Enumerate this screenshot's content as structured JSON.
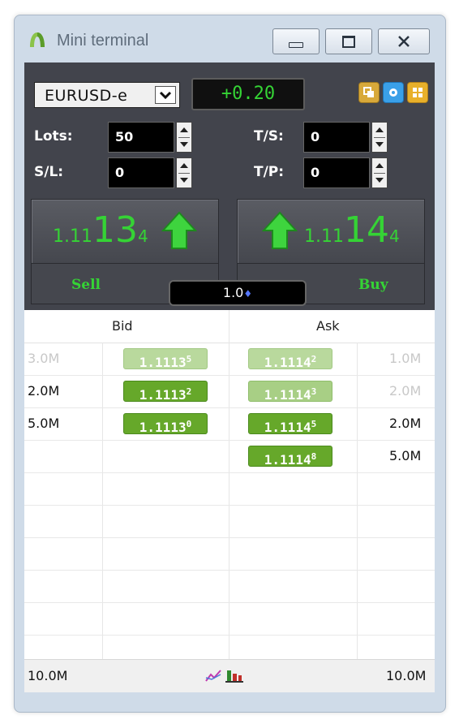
{
  "window": {
    "title": "Mini terminal",
    "buttons": {
      "minimize": "minimize",
      "maximize": "maximize",
      "close": "close"
    }
  },
  "header": {
    "symbol": "EURUSD-e",
    "profit": "+0.20",
    "tools": [
      "copy-icon",
      "settings-icon",
      "grid-icon"
    ]
  },
  "fields": {
    "lots": {
      "label": "Lots:",
      "value": "50"
    },
    "sl": {
      "label": "S/L:",
      "value": "0"
    },
    "ts": {
      "label": "T/S:",
      "value": "0"
    },
    "tp": {
      "label": "T/P:",
      "value": "0"
    }
  },
  "sell": {
    "pre": "1.11",
    "big": "13",
    "sup": "4",
    "label": "Sell"
  },
  "buy": {
    "pre": "1.11",
    "big": "14",
    "sup": "4",
    "label": "Buy"
  },
  "volume": "1.0",
  "book": {
    "headers": {
      "bid": "Bid",
      "ask": "Ask"
    },
    "rows": [
      {
        "bid_vol": "3.0M",
        "bid_price": "1.1113",
        "bid_sup": "5",
        "ask_price": "1.1114",
        "ask_sup": "2",
        "ask_vol": "1.0M"
      },
      {
        "bid_vol": "2.0M",
        "bid_price": "1.1113",
        "bid_sup": "2",
        "ask_price": "1.1114",
        "ask_sup": "3",
        "ask_vol": "2.0M"
      },
      {
        "bid_vol": "5.0M",
        "bid_price": "1.1113",
        "bid_sup": "0",
        "ask_price": "1.1114",
        "ask_sup": "5",
        "ask_vol": "2.0M"
      },
      {
        "bid_vol": "",
        "bid_price": "",
        "bid_sup": "",
        "ask_price": "1.1114",
        "ask_sup": "8",
        "ask_vol": "5.0M"
      }
    ],
    "footer": {
      "bid_total": "10.0M",
      "ask_total": "10.0M",
      "icons": [
        "chart-line-icon",
        "bar-chart-icon"
      ]
    }
  },
  "colors": {
    "accent_green": "#35d335",
    "chip_dark": "#66a82a",
    "panel": "#42444c"
  }
}
